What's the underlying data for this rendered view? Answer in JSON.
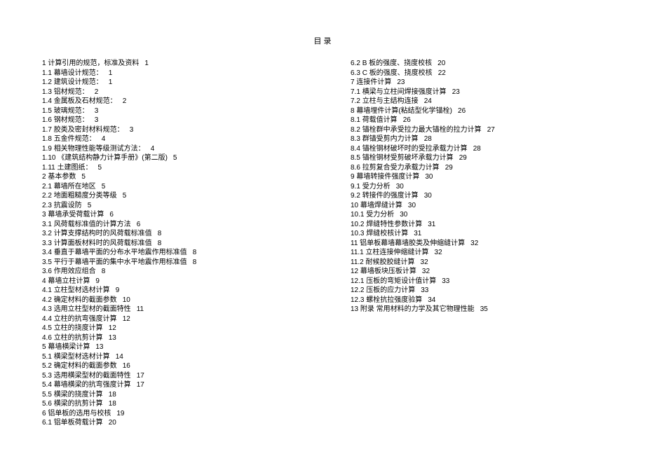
{
  "title": "目 录",
  "left_column": [
    {
      "num": "1",
      "title": "计算引用的规范，标准及资料",
      "page": "1"
    },
    {
      "num": "1.1",
      "title": "幕墙设计规范：",
      "page": "1"
    },
    {
      "num": "1.2",
      "title": "建筑设计规范：",
      "page": "1"
    },
    {
      "num": "1.3",
      "title": "铝材规范：",
      "page": "2"
    },
    {
      "num": "1.4",
      "title": "金属板及石材规范：",
      "page": "2"
    },
    {
      "num": "1.5",
      "title": "玻璃规范：",
      "page": "3"
    },
    {
      "num": "1.6",
      "title": "钢材规范：",
      "page": "3"
    },
    {
      "num": "1.7",
      "title": "胶类及密封材料规范：",
      "page": "3"
    },
    {
      "num": "1.8",
      "title": "五金件规范：",
      "page": "4"
    },
    {
      "num": "1.9",
      "title": "相关物理性能等级测试方法：",
      "page": "4"
    },
    {
      "num": "1.10",
      "title": "《建筑结构静力计算手册》(第二版)",
      "page": "5"
    },
    {
      "num": "1.11",
      "title": "土建图纸：",
      "page": "5"
    },
    {
      "num": "2",
      "title": "基本参数",
      "page": "5"
    },
    {
      "num": "2.1",
      "title": "幕墙所在地区",
      "page": "5"
    },
    {
      "num": "2.2",
      "title": "地面粗糙度分类等级",
      "page": "5"
    },
    {
      "num": "2.3",
      "title": "抗震设防",
      "page": "5"
    },
    {
      "num": "3",
      "title": "幕墙承受荷载计算",
      "page": "6"
    },
    {
      "num": "3.1",
      "title": "风荷载标准值的计算方法",
      "page": "6"
    },
    {
      "num": "3.2",
      "title": "计算支撑结构时的风荷载标准值",
      "page": "8"
    },
    {
      "num": "3.3",
      "title": "计算面板材料时的风荷载标准值",
      "page": "8"
    },
    {
      "num": "3.4",
      "title": "垂直于幕墙平面的分布水平地震作用标准值",
      "page": "8"
    },
    {
      "num": "3.5",
      "title": "平行于幕墙平面的集中水平地震作用标准值",
      "page": "8"
    },
    {
      "num": "3.6",
      "title": "作用效应组合",
      "page": "8"
    },
    {
      "num": "4",
      "title": "幕墙立柱计算",
      "page": "9"
    },
    {
      "num": "4.1",
      "title": "立柱型材选材计算",
      "page": "9"
    },
    {
      "num": "4.2",
      "title": "确定材料的截面参数",
      "page": "10"
    },
    {
      "num": "4.3",
      "title": "选用立柱型材的截面特性",
      "page": "11"
    },
    {
      "num": "4.4",
      "title": "立柱的抗弯强度计算",
      "page": "12"
    },
    {
      "num": "4.5",
      "title": "立柱的挠度计算",
      "page": "12"
    },
    {
      "num": "4.6",
      "title": "立柱的抗剪计算",
      "page": "13"
    },
    {
      "num": "5",
      "title": "幕墙横梁计算",
      "page": "13"
    },
    {
      "num": "5.1",
      "title": "横梁型材选材计算",
      "page": "14"
    },
    {
      "num": "5.2",
      "title": "确定材料的截面参数",
      "page": "16"
    },
    {
      "num": "5.3",
      "title": "选用横梁型材的截面特性",
      "page": "17"
    },
    {
      "num": "5.4",
      "title": "幕墙横梁的抗弯强度计算",
      "page": "17"
    },
    {
      "num": "5.5",
      "title": "横梁的挠度计算",
      "page": "18"
    },
    {
      "num": "5.6",
      "title": "横梁的抗剪计算",
      "page": "18"
    },
    {
      "num": "6",
      "title": "铝单板的选用与校核",
      "page": "19"
    },
    {
      "num": "6.1",
      "title": "铝单板荷载计算",
      "page": "20"
    }
  ],
  "right_column": [
    {
      "num": "6.2",
      "title": "B 板的强度、挠度校核",
      "page": "20"
    },
    {
      "num": "6.3",
      "title": "C 板的强度、挠度校核",
      "page": "22"
    },
    {
      "num": "7",
      "title": "连接件计算",
      "page": "23"
    },
    {
      "num": "7.1",
      "title": "横梁与立柱间焊接强度计算",
      "page": "23"
    },
    {
      "num": "7.2",
      "title": "立柱与主结构连接",
      "page": "24"
    },
    {
      "num": "8",
      "title": "幕墙埋件计算(粘结型化学锚栓)",
      "page": "26"
    },
    {
      "num": "8.1",
      "title": "荷载值计算",
      "page": "26"
    },
    {
      "num": "8.2",
      "title": "锚栓群中承受拉力最大锚栓的拉力计算",
      "page": "27"
    },
    {
      "num": "8.3",
      "title": "群锚受剪内力计算",
      "page": "28"
    },
    {
      "num": "8.4",
      "title": "锚栓钢材破坏时的受拉承载力计算",
      "page": "28"
    },
    {
      "num": "8.5",
      "title": "锚栓钢材受剪破坏承载力计算",
      "page": "29"
    },
    {
      "num": "8.6",
      "title": "拉剪复合受力承载力计算",
      "page": "29"
    },
    {
      "num": "9",
      "title": "幕墙转接件强度计算",
      "page": "30"
    },
    {
      "num": "9.1",
      "title": "受力分析",
      "page": "30"
    },
    {
      "num": "9.2",
      "title": "转接件的强度计算",
      "page": "30"
    },
    {
      "num": "10",
      "title": "幕墙焊缝计算",
      "page": "30"
    },
    {
      "num": "10.1",
      "title": "受力分析",
      "page": "30"
    },
    {
      "num": "10.2",
      "title": "焊缝特性参数计算",
      "page": "31"
    },
    {
      "num": "10.3",
      "title": "焊缝校核计算",
      "page": "31"
    },
    {
      "num": "11",
      "title": "铝单板幕墙幕墙胶类及伸缩缝计算",
      "page": "32"
    },
    {
      "num": "11.1",
      "title": "立柱连接伸缩缝计算",
      "page": "32"
    },
    {
      "num": "11.2",
      "title": "耐候胶胶缝计算",
      "page": "32"
    },
    {
      "num": "12",
      "title": "幕墙板块压板计算",
      "page": "32"
    },
    {
      "num": "12.1",
      "title": "压板的弯矩设计值计算",
      "page": "33"
    },
    {
      "num": "12.2",
      "title": "压板的应力计算",
      "page": "33"
    },
    {
      "num": "12.3",
      "title": "螺栓抗拉强度验算",
      "page": "34"
    },
    {
      "num": "13",
      "title": "附录  常用材料的力学及其它物理性能",
      "page": "35"
    }
  ]
}
